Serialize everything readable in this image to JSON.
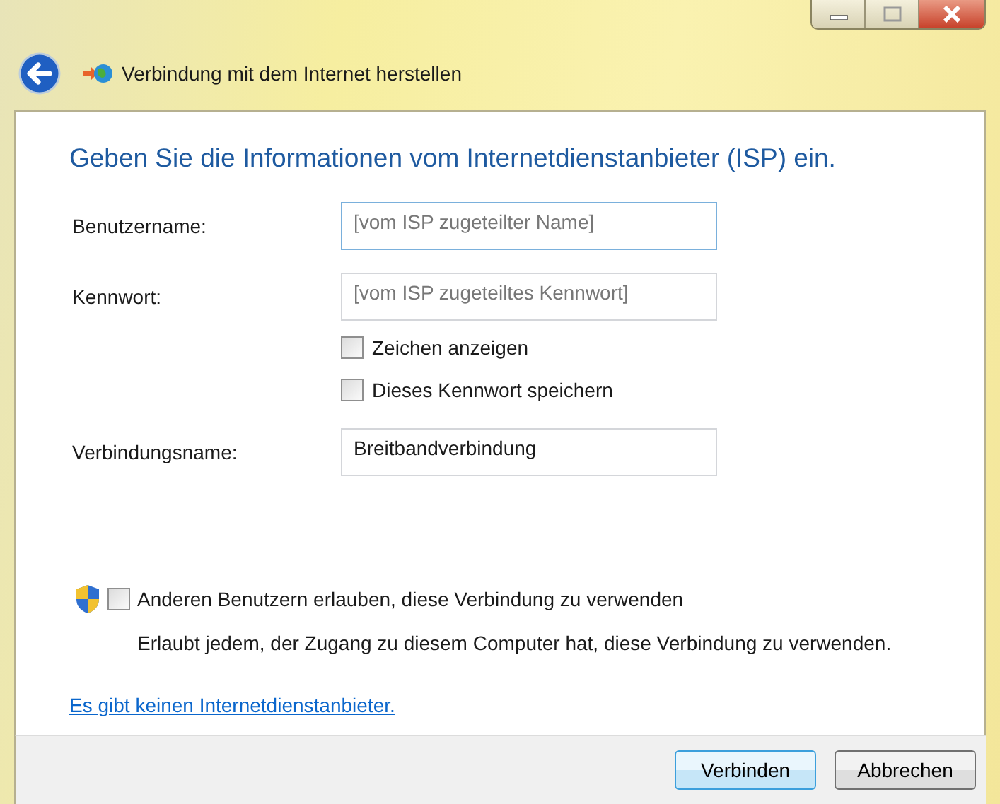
{
  "window": {
    "title": "Verbindung mit dem Internet herstellen"
  },
  "form": {
    "heading": "Geben Sie die Informationen vom Internetdienstanbieter (ISP) ein.",
    "rows": [
      {
        "kind": "field",
        "label": "Benutzername:",
        "placeholder": "[vom ISP zugeteilter Name]",
        "focused": true
      },
      {
        "kind": "field",
        "label": "Kennwort:",
        "placeholder": "[vom ISP zugeteiltes Kennwort]",
        "focused": false
      },
      {
        "kind": "checkbox",
        "label": "Zeichen anzeigen",
        "checked": false
      },
      {
        "kind": "checkbox",
        "label": "Dieses Kennwort speichern",
        "checked": false
      },
      {
        "kind": "field",
        "label": "Verbindungsname:",
        "value": "Breitbandverbindung",
        "focused": false
      }
    ]
  },
  "sharing": {
    "label": "Anderen Benutzern erlauben, diese Verbindung zu verwenden",
    "checked": false,
    "description": "Erlaubt jedem, der Zugang zu diesem Computer hat, diese Verbindung zu verwenden."
  },
  "link": "Es gibt keinen Internetdienstanbieter.",
  "buttons": [
    {
      "label": "Verbinden",
      "default": true
    },
    {
      "label": "Abbrechen",
      "default": false
    }
  ]
}
